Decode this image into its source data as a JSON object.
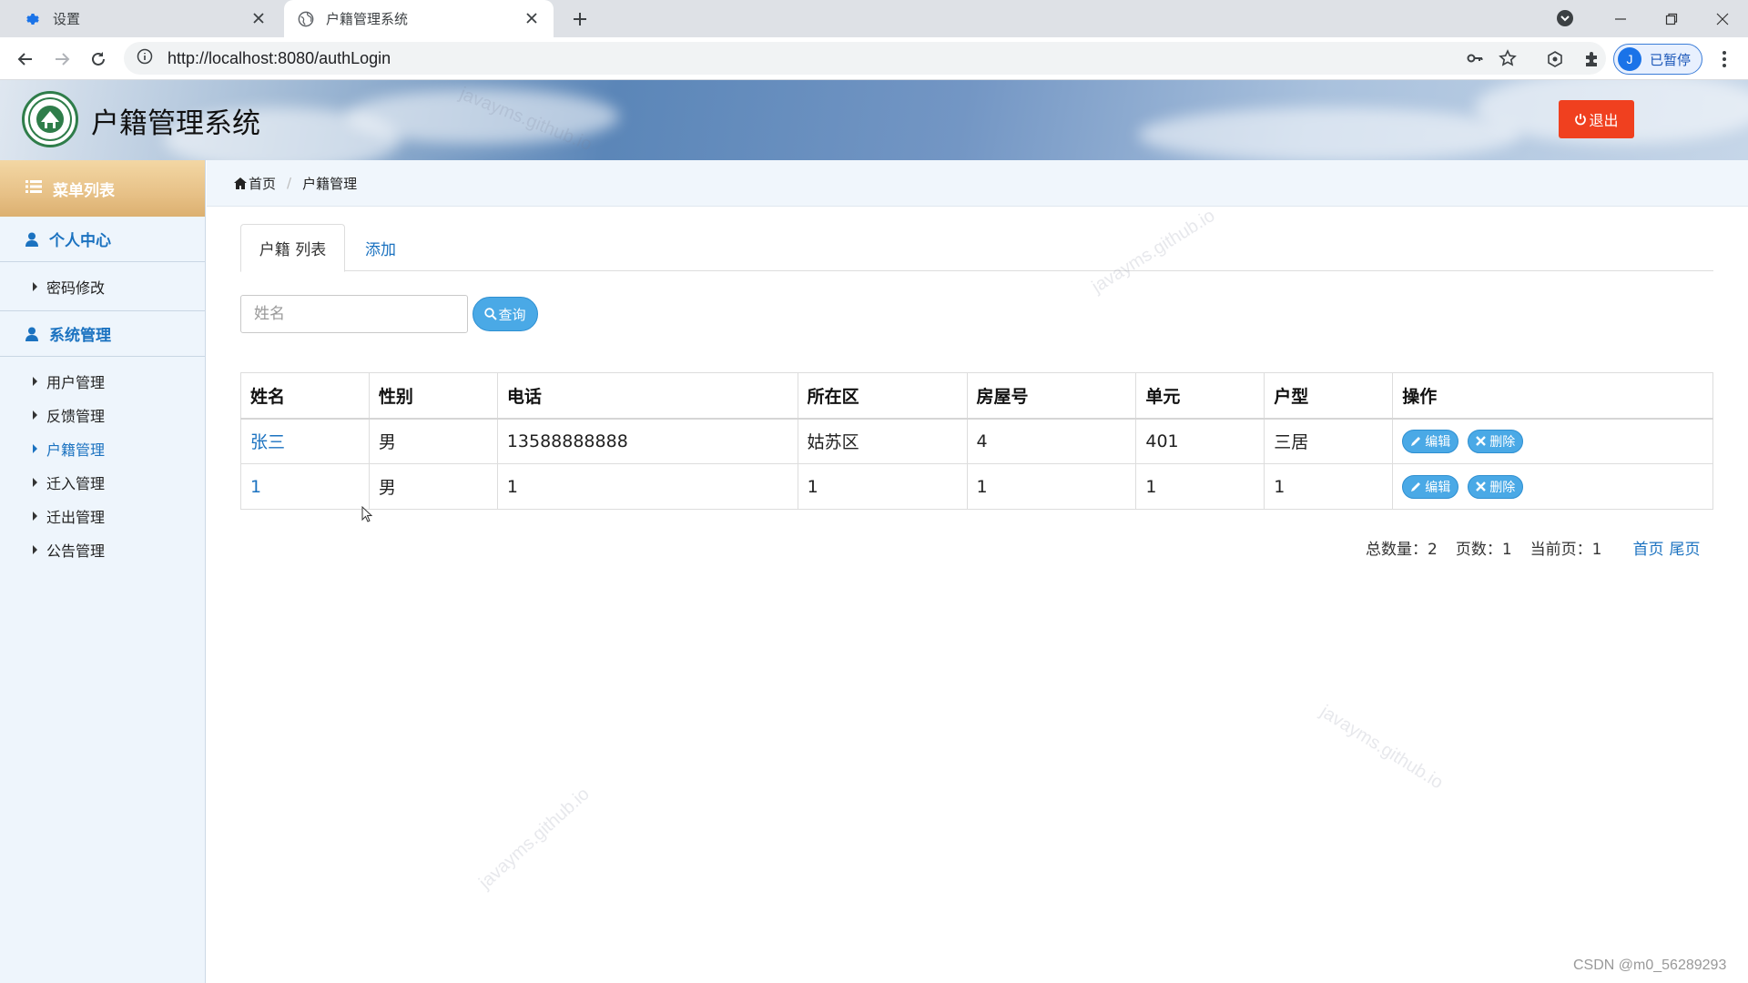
{
  "browser": {
    "tabs": [
      {
        "title": "设置",
        "icon": "gear-icon"
      },
      {
        "title": "户籍管理系统",
        "icon": "globe-icon"
      }
    ],
    "url": "http://localhost:8080/authLogin",
    "profile": {
      "initial": "J",
      "label": "已暂停"
    }
  },
  "header": {
    "title": "户籍管理系统",
    "logout_label": "退出"
  },
  "sidebar": {
    "menu_title": "菜单列表",
    "sections": [
      {
        "title": "个人中心",
        "items": [
          "密码修改"
        ]
      },
      {
        "title": "系统管理",
        "items": [
          "用户管理",
          "反馈管理",
          "户籍管理",
          "迁入管理",
          "迁出管理",
          "公告管理"
        ]
      }
    ],
    "active_item": "户籍管理"
  },
  "breadcrumb": {
    "home": "首页",
    "current": "户籍管理"
  },
  "tabs": {
    "list": "户籍 列表",
    "add": "添加"
  },
  "search": {
    "placeholder": "姓名",
    "button": "查询"
  },
  "table": {
    "headers": [
      "姓名",
      "性别",
      "电话",
      "所在区",
      "房屋号",
      "单元",
      "户型",
      "操作"
    ],
    "rows": [
      [
        "张三",
        "男",
        "13588888888",
        "姑苏区",
        "4",
        "401",
        "三居"
      ],
      [
        "1",
        "男",
        "1",
        "1",
        "1",
        "1",
        "1"
      ]
    ],
    "edit_label": "编辑",
    "delete_label": "删除"
  },
  "pager": {
    "total": "总数量：2",
    "pages": "页数：1",
    "current": "当前页：1",
    "first": "首页",
    "last": "尾页"
  },
  "watermark": "javayms.github.io",
  "footer_credit": "CSDN @m0_56289293",
  "colors": {
    "accent": "#1b72c0",
    "logout": "#f0401f",
    "button": "#4aa9e6"
  }
}
